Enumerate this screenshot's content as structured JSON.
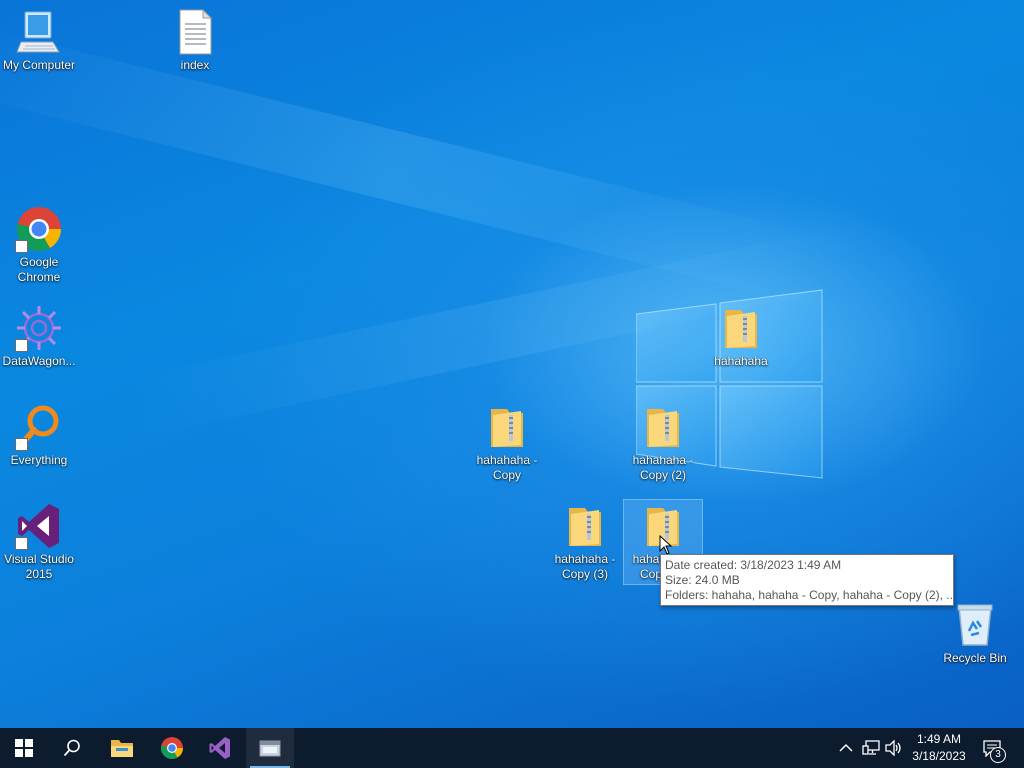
{
  "desktop": {
    "icons": [
      {
        "label": "My Computer",
        "icon": "computer-icon"
      },
      {
        "label": "index",
        "icon": "text-file-icon"
      },
      {
        "label": "Google Chrome",
        "icon": "chrome-icon"
      },
      {
        "label": "DataWagon...",
        "icon": "datawagon-icon"
      },
      {
        "label": "Everything",
        "icon": "everything-icon"
      },
      {
        "label": "Visual Studio 2015",
        "icon": "visual-studio-icon"
      },
      {
        "label": "hahahaha",
        "icon": "folder-icon"
      },
      {
        "label": "hahahaha - Copy",
        "icon": "folder-icon"
      },
      {
        "label": "hahahaha - Copy (2)",
        "icon": "folder-icon"
      },
      {
        "label": "hahahaha - Copy (3)",
        "icon": "folder-icon"
      },
      {
        "label": "hahahaha - Copy (4)",
        "icon": "folder-icon"
      },
      {
        "label": "Recycle Bin",
        "icon": "recycle-bin-icon"
      }
    ]
  },
  "tooltip": {
    "date_created": "Date created: 3/18/2023 1:49 AM",
    "size": "Size: 24.0 MB",
    "folders": "Folders: hahaha, hahaha - Copy, hahaha - Copy (2), ..."
  },
  "taskbar": {
    "buttons": [
      {
        "name": "start",
        "icon": "windows-start-icon"
      },
      {
        "name": "search",
        "icon": "search-icon"
      },
      {
        "name": "file-explorer",
        "icon": "file-explorer-icon"
      },
      {
        "name": "chrome",
        "icon": "chrome-icon"
      },
      {
        "name": "visual-studio",
        "icon": "visual-studio-icon"
      },
      {
        "name": "app",
        "icon": "app-window-icon"
      }
    ],
    "tray": {
      "icons": [
        "chevron-up-icon",
        "network-icon",
        "volume-icon"
      ]
    },
    "clock": {
      "time": "1:49 AM",
      "date": "3/18/2023"
    },
    "notifications": {
      "icon": "action-center-icon",
      "count": "3"
    }
  },
  "colors": {
    "taskbar_bg": "#0d1b2e",
    "accent": "#76b9ed",
    "desktop_blue": "#0a78da"
  }
}
